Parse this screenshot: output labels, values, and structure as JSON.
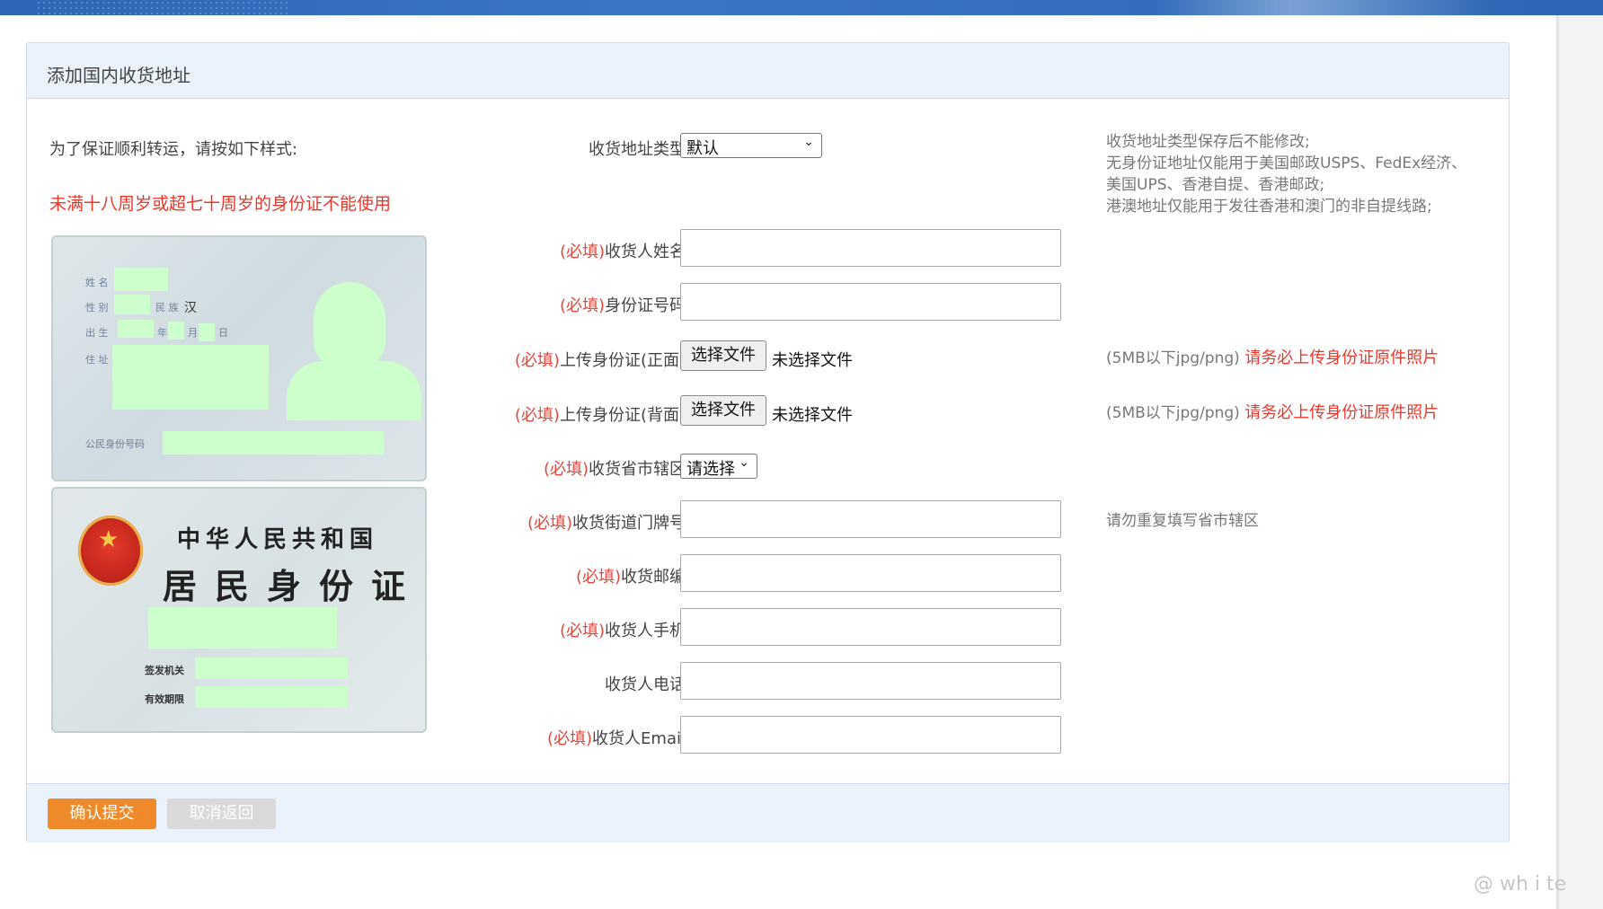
{
  "panel": {
    "title": "添加国内收货地址",
    "intro": "为了保证顺利转运，请按如下样式:",
    "warning": "未满十八周岁或超七十周岁的身份证不能使用"
  },
  "id_card": {
    "front_labels": {
      "name": "姓 名",
      "gender": "性 别",
      "ethnicity_label": "民 族",
      "ethnicity_value": "汉",
      "birth": "出 生",
      "year": "年",
      "month": "月",
      "day": "日",
      "address": "住 址",
      "id_number": "公民身份号码"
    },
    "back_labels": {
      "title_line1": "中华人民共和国",
      "title_line2": "居民身份证",
      "issuer": "签发机关",
      "validity": "有效期限"
    }
  },
  "form": {
    "required_tag": "(必填)",
    "address_type": {
      "label": "收货地址类型",
      "selected": "默认"
    },
    "name": {
      "label": "收货人姓名",
      "required": true
    },
    "id_number": {
      "label": "身份证号码",
      "required": true
    },
    "id_front": {
      "label": "上传身份证(正面)",
      "button": "选择文件",
      "status": "未选择文件"
    },
    "id_back": {
      "label": "上传身份证(背面)",
      "button": "选择文件",
      "status": "未选择文件"
    },
    "region": {
      "label": "收货省市辖区",
      "selected": "请选择"
    },
    "street": {
      "label": "收货街道门牌号"
    },
    "postcode": {
      "label": "收货邮编"
    },
    "mobile": {
      "label": "收货人手机"
    },
    "phone": {
      "label": "收货人电话"
    },
    "email": {
      "label": "收货人Email"
    }
  },
  "hints": {
    "address_type": [
      "收货地址类型保存后不能修改;",
      "无身份证地址仅能用于美国邮政USPS、FedEx经济、",
      "美国UPS、香港自提、香港邮政;",
      "港澳地址仅能用于发往香港和澳门的非自提线路;"
    ],
    "upload_size": "(5MB以下jpg/png)",
    "upload_warning": "请务必上传身份证原件照片",
    "street": "请勿重复填写省市辖区"
  },
  "footer": {
    "submit": "确认提交",
    "cancel": "取消返回"
  },
  "watermark": "@ wh i te",
  "colors": {
    "accent": "#ef8a2a",
    "required": "#e0483c",
    "warning": "#e8382c",
    "header_bg": "#eaf2fb",
    "topbar": "#2f66b3"
  }
}
